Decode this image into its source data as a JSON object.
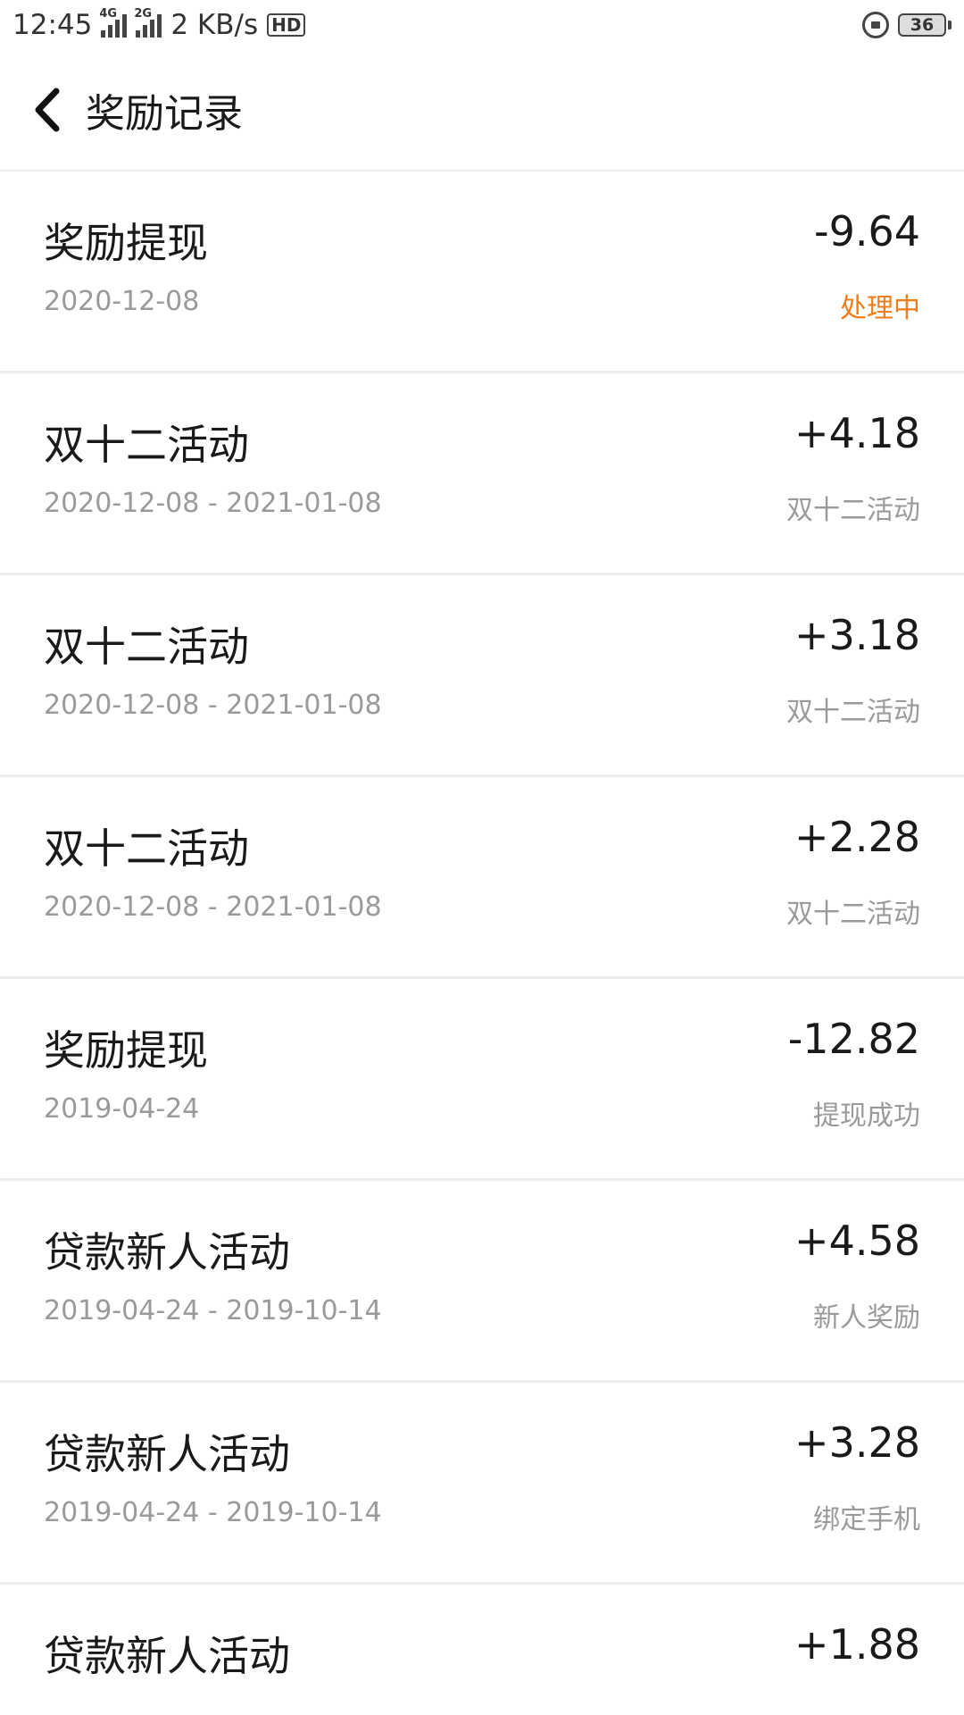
{
  "status_bar": {
    "time": "12:45",
    "network_1": "4G",
    "network_2": "2G",
    "speed": "2 KB/s",
    "hd": "HD",
    "battery": "36"
  },
  "header": {
    "title": "奖励记录"
  },
  "records": [
    {
      "name": "奖励提现",
      "date": "2020-12-08",
      "amount": "-9.64",
      "status": "处理中",
      "status_color": "#f07d1a"
    },
    {
      "name": "双十二活动",
      "date": "2020-12-08 - 2021-01-08",
      "amount": "+4.18",
      "status": "双十二活动"
    },
    {
      "name": "双十二活动",
      "date": "2020-12-08 - 2021-01-08",
      "amount": "+3.18",
      "status": "双十二活动"
    },
    {
      "name": "双十二活动",
      "date": "2020-12-08 - 2021-01-08",
      "amount": "+2.28",
      "status": "双十二活动"
    },
    {
      "name": "奖励提现",
      "date": "2019-04-24",
      "amount": "-12.82",
      "status": "提现成功"
    },
    {
      "name": "贷款新人活动",
      "date": "2019-04-24 - 2019-10-14",
      "amount": "+4.58",
      "status": "新人奖励"
    },
    {
      "name": "贷款新人活动",
      "date": "2019-04-24 - 2019-10-14",
      "amount": "+3.28",
      "status": "绑定手机"
    },
    {
      "name": "贷款新人活动",
      "date": "",
      "amount": "+1.88",
      "status": ""
    }
  ]
}
